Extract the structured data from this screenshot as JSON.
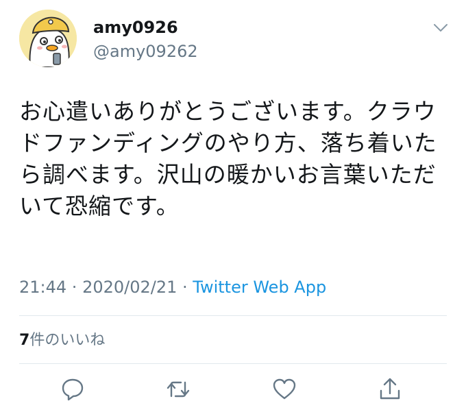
{
  "user": {
    "display_name": "amy0926",
    "handle": "@amy09262"
  },
  "tweet": {
    "text": "お心遣いありがとうございます。クラウドファンディングのやり方、落ち着いたら調べます。沢山の暖かいお言葉いただいて恐縮です。",
    "time": "21:44",
    "date": "2020/02/21",
    "separator": " · ",
    "app": "Twitter Web App"
  },
  "likes": {
    "count": "7",
    "label": "件のいいね"
  },
  "icons": {
    "more": "chevron-down-icon",
    "reply": "reply-icon",
    "retweet": "retweet-icon",
    "like": "heart-icon",
    "share": "share-icon"
  },
  "colors": {
    "primary_text": "#14171a",
    "secondary_text": "#657786",
    "link": "#1b95e0",
    "divider": "#e1e8ed"
  }
}
